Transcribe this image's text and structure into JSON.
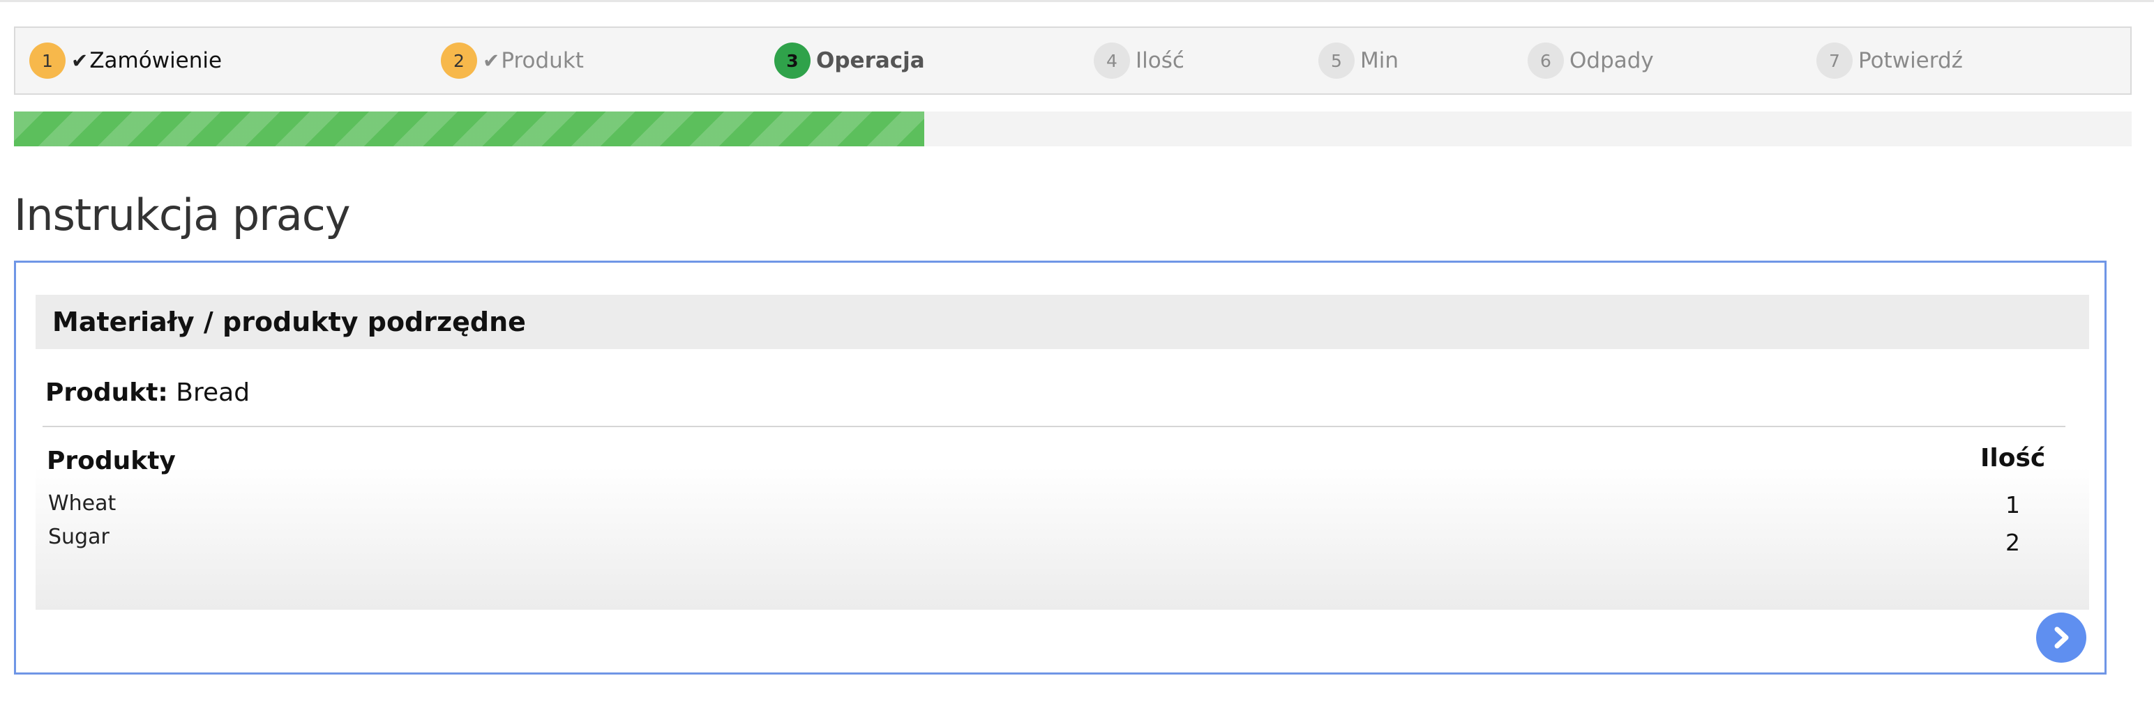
{
  "wizard": {
    "steps": [
      {
        "number": "1",
        "label": "Zamówienie",
        "state": "done"
      },
      {
        "number": "2",
        "label": "Produkt",
        "state": "done"
      },
      {
        "number": "3",
        "label": "Operacja",
        "state": "active"
      },
      {
        "number": "4",
        "label": "Ilość",
        "state": "pending"
      },
      {
        "number": "5",
        "label": "Min",
        "state": "pending"
      },
      {
        "number": "6",
        "label": "Odpady",
        "state": "pending"
      },
      {
        "number": "7",
        "label": "Potwierdź",
        "state": "pending"
      }
    ],
    "check_icon": "check-icon"
  },
  "progress": {
    "fraction": 0.43,
    "color": "#5cbf5c"
  },
  "page": {
    "title": "Instrukcja pracy"
  },
  "panel": {
    "header": "Materiały / produkty podrzędne",
    "product_label": "Produkt:",
    "product_value": "Bread",
    "table": {
      "headers": {
        "product": "Produkty",
        "qty": "Ilość"
      },
      "rows": [
        {
          "product": "Wheat",
          "qty": "1"
        },
        {
          "product": "Sugar",
          "qty": "2"
        }
      ]
    },
    "next_icon": "chevron-right-icon"
  },
  "colors": {
    "accent": "#6f96e6",
    "done": "#f7b84b",
    "active": "#2fa24a"
  }
}
